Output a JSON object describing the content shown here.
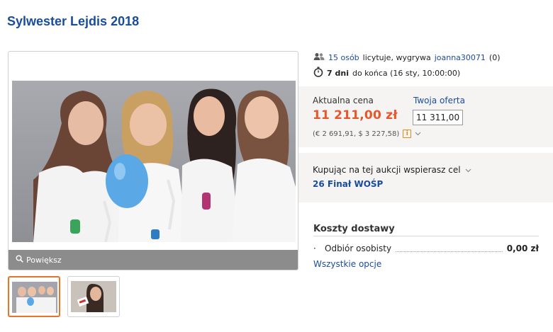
{
  "title": "Sylwester Lejdis 2018",
  "gallery": {
    "zoom_label": "Powiększ"
  },
  "bidders": {
    "count_link": "15 osób",
    "text": "licytuje, wygrywa",
    "winner": "joanna30071",
    "winner_score": "(0)"
  },
  "time": {
    "days": "7 dni",
    "text": "do końca (16 sty, 10:00:00)"
  },
  "price": {
    "label": "Aktualna cena",
    "value": "11 211,00 zł",
    "conversion": "(€ 2 691,91, $ 3 227,58)",
    "info_glyph": "i"
  },
  "offer": {
    "label": "Twoja oferta",
    "value": "11 311,00"
  },
  "charity": {
    "label": "Kupując na tej aukcji wspierasz cel",
    "name": "26 Finał WOŚP"
  },
  "shipping": {
    "title": "Koszty dostawy",
    "option_name": "Odbiór osobisty",
    "option_price": "0,00 zł",
    "all_options": "Wszystkie opcje"
  },
  "colors": {
    "link": "#1a4c9c",
    "price": "#e8562a",
    "box_bg": "#f5f4f2",
    "active_thumb": "#e8742a"
  }
}
